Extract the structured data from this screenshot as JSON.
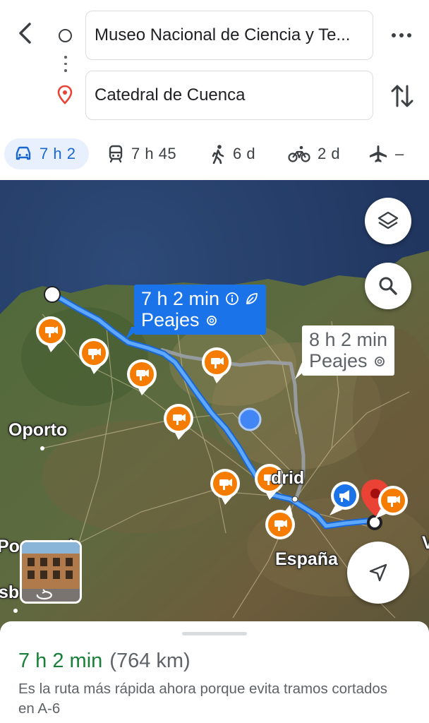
{
  "search": {
    "origin": "Museo Nacional de Ciencia y Te...",
    "destination": "Catedral de Cuenca"
  },
  "modes": [
    {
      "name": "car",
      "label": "7 h 2",
      "selected": true
    },
    {
      "name": "transit",
      "label": "7 h 45",
      "selected": false
    },
    {
      "name": "walk",
      "label": "6 d",
      "selected": false
    },
    {
      "name": "bike",
      "label": "2 d",
      "selected": false
    },
    {
      "name": "flight",
      "label": "–",
      "selected": false
    }
  ],
  "map": {
    "primary_route": {
      "time": "7 h 2 min",
      "note": "Peajes"
    },
    "alt_route": {
      "time": "8 h 2 min",
      "note": "Peajes"
    },
    "labels": {
      "oporto": "Oporto",
      "madrid": "drid",
      "portugal": "Po        al",
      "espana": "España",
      "lisboa": "sb",
      "edge": "V"
    }
  },
  "summary": {
    "time": "7 h 2 min",
    "distance": "(764 km)",
    "description": "Es la ruta más rápida ahora porque evita tramos cortados en A-6"
  },
  "colors": {
    "accent_blue": "#1a73e8",
    "route_blue": "#4285f4",
    "time_green": "#188038",
    "camera_orange": "#f57c00",
    "pin_red": "#ea4335"
  }
}
